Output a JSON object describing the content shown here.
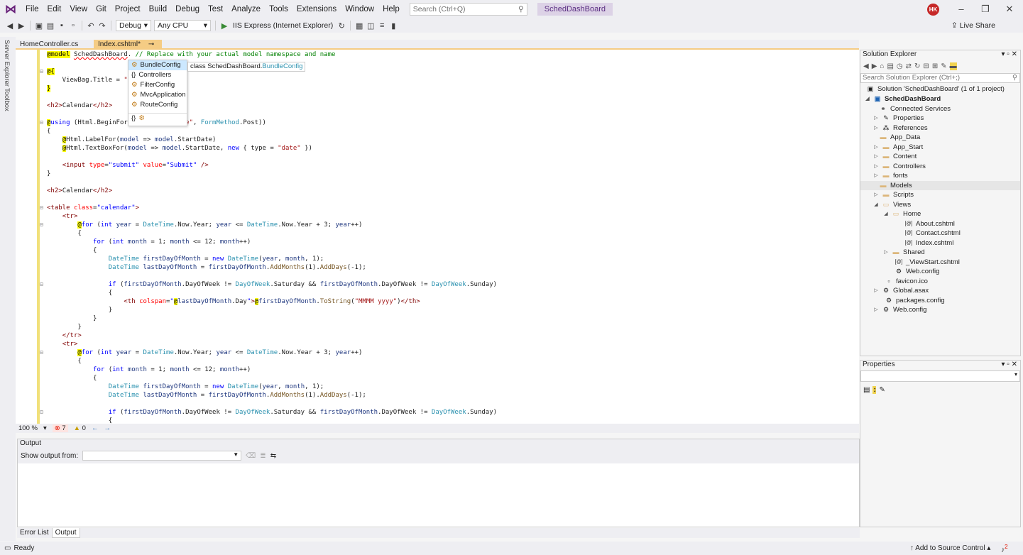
{
  "menubar": {
    "items": [
      "File",
      "Edit",
      "View",
      "Git",
      "Project",
      "Build",
      "Debug",
      "Test",
      "Analyze",
      "Tools",
      "Extensions",
      "Window",
      "Help"
    ],
    "search_placeholder": "Search (Ctrl+Q)",
    "solution_name": "SchedDashBoard",
    "avatar_initials": "HK"
  },
  "toolbar": {
    "config": "Debug",
    "platform": "Any CPU",
    "run_target": "IIS Express (Internet Explorer)",
    "live_share": "Live Share"
  },
  "sidestrip": {
    "server_explorer": "Server Explorer",
    "toolbox": "Toolbox"
  },
  "tabs": [
    {
      "label": "HomeController.cs"
    },
    {
      "label": "Index.cshtml*"
    }
  ],
  "completion": {
    "items": [
      "BundleConfig",
      "Controllers",
      "FilterConfig",
      "MvcApplication",
      "RouteConfig"
    ],
    "tooltip_prefix": "class SchedDashBoard.",
    "tooltip_type": "BundleConfig"
  },
  "editor_status": {
    "zoom": "100 %",
    "errors": "7",
    "warnings": "0"
  },
  "output": {
    "title": "Output",
    "show_from_label": "Show output from:"
  },
  "bottom_tabs": [
    "Error List",
    "Output"
  ],
  "solution_explorer": {
    "title": "Solution Explorer",
    "search_placeholder": "Search Solution Explorer (Ctrl+;)",
    "items": [
      {
        "label": "Solution 'SchedDashBoard' (1 of 1 project)"
      },
      {
        "label": "SchedDashBoard"
      },
      {
        "label": "Connected Services"
      },
      {
        "label": "Properties"
      },
      {
        "label": "References"
      },
      {
        "label": "App_Data"
      },
      {
        "label": "App_Start"
      },
      {
        "label": "Content"
      },
      {
        "label": "Controllers"
      },
      {
        "label": "fonts"
      },
      {
        "label": "Models"
      },
      {
        "label": "Scripts"
      },
      {
        "label": "Views"
      },
      {
        "label": "Home"
      },
      {
        "label": "About.cshtml"
      },
      {
        "label": "Contact.cshtml"
      },
      {
        "label": "Index.cshtml"
      },
      {
        "label": "Shared"
      },
      {
        "label": "_ViewStart.cshtml"
      },
      {
        "label": "Web.config"
      },
      {
        "label": "favicon.ico"
      },
      {
        "label": "Global.asax"
      },
      {
        "label": "packages.config"
      },
      {
        "label": "Web.config"
      }
    ]
  },
  "properties": {
    "title": "Properties"
  },
  "statusbar": {
    "ready": "Ready",
    "source_control": "Add to Source Control",
    "notifications": "2"
  },
  "colors": {
    "accent": "#68217a",
    "error": "#e51400",
    "warning": "#f2c811"
  }
}
